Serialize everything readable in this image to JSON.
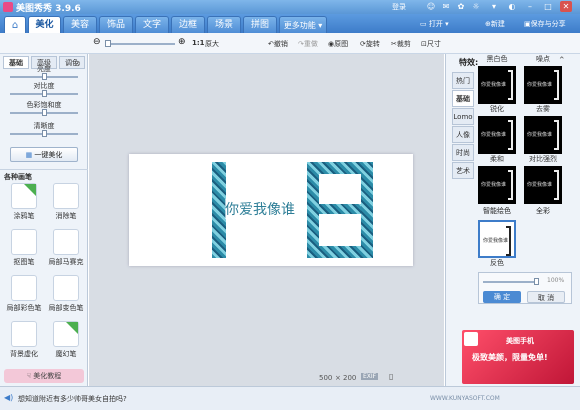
{
  "title": "美图秀秀 3.9.6",
  "titlebar": {
    "login": "登录"
  },
  "tabs": [
    {
      "label": "美化"
    },
    {
      "label": "美容"
    },
    {
      "label": "饰品"
    },
    {
      "label": "文字"
    },
    {
      "label": "边框"
    },
    {
      "label": "场景"
    },
    {
      "label": "拼图"
    },
    {
      "label": "更多功能 ▾"
    }
  ],
  "actions": {
    "open": "打开",
    "new": "新建",
    "save": "保存与分享"
  },
  "toolbar": {
    "zoom": "1:1",
    "orig": "原大",
    "undo": "撤销",
    "redo": "重做",
    "original": "原图",
    "rotate": "旋转",
    "crop": "裁剪",
    "resize": "尺寸"
  },
  "left": {
    "subtabs": [
      "基础",
      "高级",
      "调色"
    ],
    "sliders": [
      "亮度",
      "对比度",
      "色彩饱和度",
      "清晰度"
    ],
    "slider_levels": [
      0.5,
      0.5,
      0.5,
      0.5
    ],
    "onekey": "一键美化",
    "brush_title": "各种画笔",
    "brushes": [
      {
        "label": "涂鸦笔",
        "icon": "pencil-icon",
        "new": true
      },
      {
        "label": "消除笔",
        "icon": "eraser-icon",
        "new": false
      },
      {
        "label": "抠图笔",
        "icon": "cutout-pen-icon",
        "new": false
      },
      {
        "label": "局部马赛克",
        "icon": "mosaic-icon",
        "new": false
      },
      {
        "label": "局部彩色笔",
        "icon": "color-brush-icon",
        "new": false
      },
      {
        "label": "局部变色笔",
        "icon": "recolor-brush-icon",
        "new": false
      },
      {
        "label": "背景虚化",
        "icon": "blur-icon",
        "new": false
      },
      {
        "label": "魔幻笔",
        "icon": "magic-pen-icon",
        "new": true
      }
    ],
    "tutorial": "美化教程"
  },
  "canvas": {
    "image_text": "你爱我像谁",
    "image_glyph": "|日",
    "size_w": "500",
    "size_x": "×",
    "size_h": "200",
    "exif": "EXIF"
  },
  "right": {
    "title": "特效:",
    "vtabs": [
      "热门",
      "基础",
      "Lomo",
      "人像",
      "时尚",
      "艺术"
    ],
    "effects": [
      {
        "label": "黑白色"
      },
      {
        "label": "噪点"
      },
      {
        "label": "锐化"
      },
      {
        "label": "去雾"
      },
      {
        "label": "柔和"
      },
      {
        "label": "对比强烈"
      },
      {
        "label": "智能绘色"
      },
      {
        "label": "全彩"
      }
    ],
    "thumb_text": "你爱我像谁",
    "selected_label": "反色",
    "opacity": "100%",
    "opacity_level": 1.0,
    "confirm": "确 定",
    "cancel": "取 消",
    "ad_title": "美图手机",
    "ad_line": "极致美颜，限量免单!"
  },
  "status": {
    "tip": "想知道附近有多少帅哥美女自拍吗?",
    "watermark": "WWW.KUNYASOFT.COM"
  },
  "colors": {
    "accent": "#3d7cc9",
    "pattern": "#2c8ca8"
  }
}
